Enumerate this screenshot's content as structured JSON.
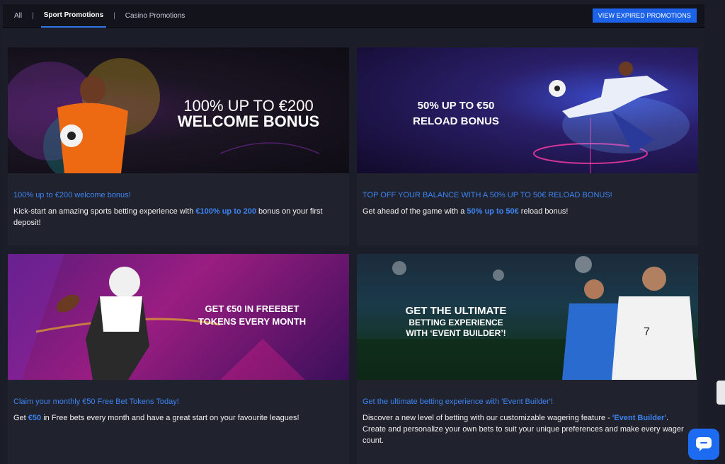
{
  "tabs": [
    {
      "label": "All"
    },
    {
      "label": "Sport Promotions"
    },
    {
      "label": "Casino Promotions"
    }
  ],
  "separators": [
    "|",
    "|"
  ],
  "expired_button": "VIEW EXPIRED PROMOTIONS",
  "cards": [
    {
      "banner_lines": [
        "100% UP TO €200",
        "WELCOME BONUS"
      ],
      "title": "100% up to €200 welcome bonus!",
      "desc_pre": "Kick-start an amazing sports betting experience with ",
      "desc_hl": "€100% up to 200",
      "desc_post": " bonus on your first deposit!"
    },
    {
      "banner_lines": [
        "50% UP TO €50",
        "RELOAD BONUS"
      ],
      "title": "TOP OFF YOUR BALANCE WITH A 50% UP TO 50€ RELOAD BONUS!",
      "desc_pre": "Get ahead of the game with a ",
      "desc_hl": "50% up to 50€",
      "desc_post": " reload bonus!"
    },
    {
      "banner_lines": [
        "GET €50 IN FREEBET",
        "TOKENS EVERY MONTH"
      ],
      "title": "Claim your monthly €50 Free Bet Tokens Today!",
      "desc_pre": "Get ",
      "desc_hl": "€50",
      "desc_post": " in Free bets every month and have a great start on your favourite leagues!"
    },
    {
      "banner_lines": [
        "GET THE ULTIMATE",
        "BETTING EXPERIENCE",
        "WITH ‘EVENT BUILDER’!"
      ],
      "title": "Get the ultimate betting experience with 'Event Builder'!",
      "desc_pre": "Discover a new level of betting with our customizable wagering feature - ",
      "desc_hl": "'Event Builder'",
      "desc_post": ". Create and personalize your own bets to suit your unique preferences and make every wager count."
    }
  ],
  "colors": {
    "accent": "#1d63ea",
    "link": "#3d84f2",
    "page_bg": "#1b1e29"
  },
  "icons": {
    "chat": "chat-bubble-icon"
  }
}
